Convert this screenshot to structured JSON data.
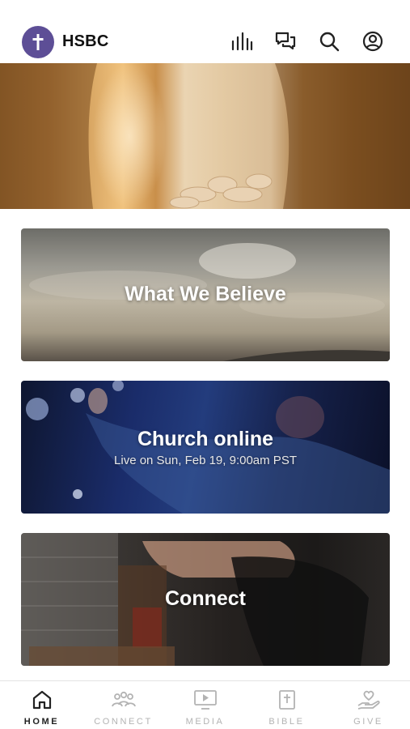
{
  "header": {
    "app_name": "HSBC",
    "logo_icon": "cross-icon",
    "logo_color": "#5d4e96",
    "actions": [
      "audio-bars-icon",
      "chat-icon",
      "search-icon",
      "account-icon"
    ]
  },
  "cards": [
    {
      "title": "What We Believe"
    },
    {
      "title": "Church online",
      "subtitle": "Live on Sun, Feb 19, 9:00am PST"
    },
    {
      "title": "Connect"
    }
  ],
  "tabs": [
    {
      "label": "HOME",
      "icon": "home-icon",
      "active": true
    },
    {
      "label": "CONNECT",
      "icon": "people-icon",
      "active": false
    },
    {
      "label": "MEDIA",
      "icon": "play-screen-icon",
      "active": false
    },
    {
      "label": "BIBLE",
      "icon": "bible-icon",
      "active": false
    },
    {
      "label": "GIVE",
      "icon": "give-heart-hand-icon",
      "active": false
    }
  ],
  "colors": {
    "tab_active": "#222222",
    "tab_inactive": "#b3b3b3"
  }
}
